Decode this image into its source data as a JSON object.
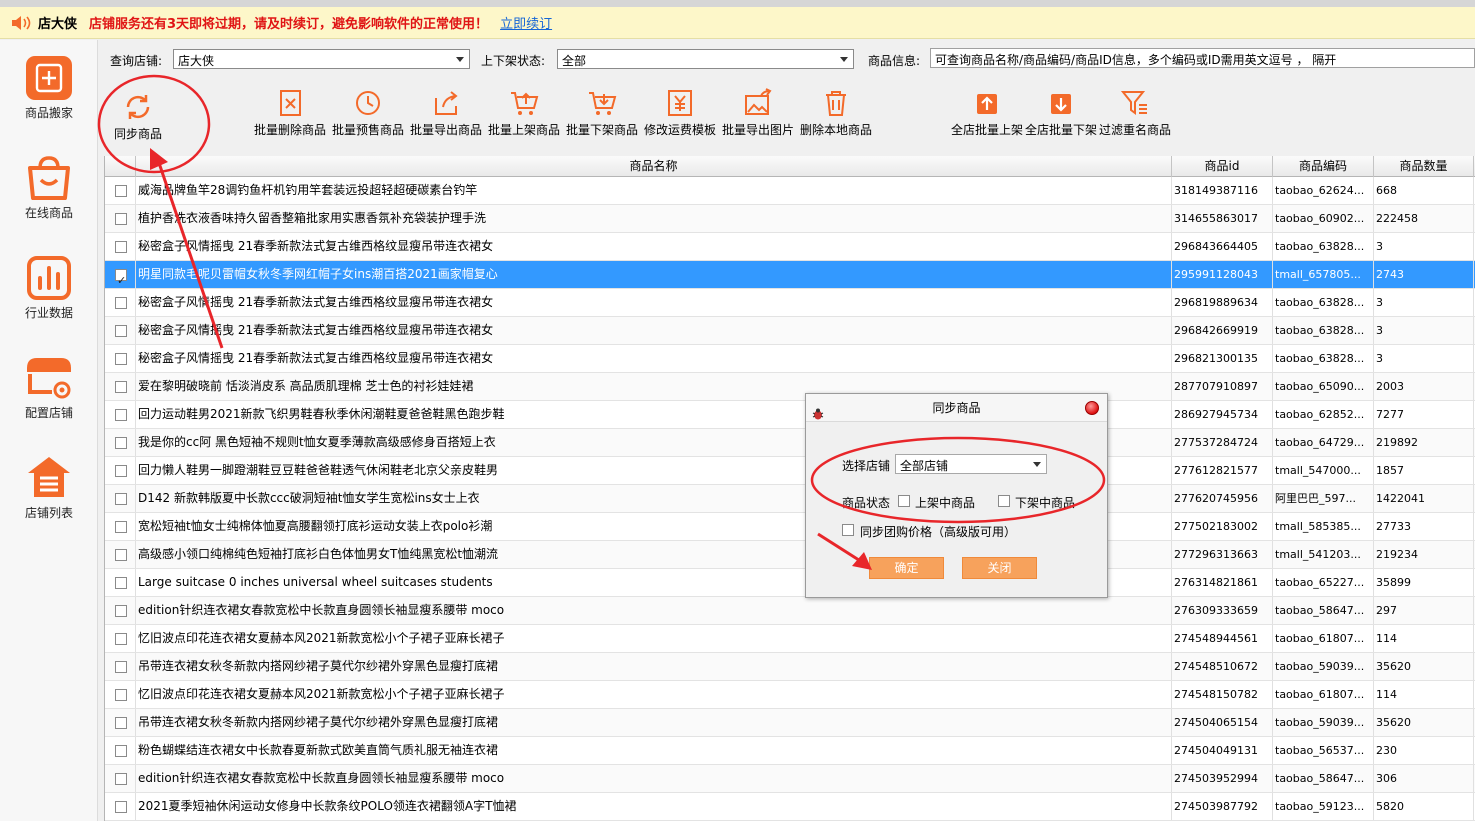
{
  "banner": {
    "brand": "店大侠",
    "message": "店铺服务还有3天即将过期，请及时续订，避免影响软件的正常使用！",
    "renew_link": "立即续订"
  },
  "sidebar": {
    "items": [
      {
        "label": "商品搬家",
        "icon": "product-move-icon"
      },
      {
        "label": "在线商品",
        "icon": "shopping-bag-icon"
      },
      {
        "label": "行业数据",
        "icon": "bar-chart-icon"
      },
      {
        "label": "配置店铺",
        "icon": "shop-settings-icon"
      },
      {
        "label": "店铺列表",
        "icon": "shop-list-icon"
      }
    ],
    "accent": "#f36a2a"
  },
  "filters": {
    "shop_label": "查询店铺:",
    "shop_value": "店大侠",
    "status_label": "上下架状态:",
    "status_value": "全部",
    "info_label": "商品信息:",
    "info_placeholder": "可查询商品名称/商品编码/商品ID信息，多个编码或ID需用英文逗号 ， 隔开"
  },
  "toolbar": {
    "sync": "同步商品",
    "batch_delete": "批量删除商品",
    "batch_presale": "批量预售商品",
    "batch_export": "批量导出商品",
    "batch_list": "批量上架商品",
    "batch_delist": "批量下架商品",
    "edit_shipping": "修改运费模板",
    "export_images": "批量导出图片",
    "delete_local": "删除本地商品",
    "shop_list_all": "全店批量上架",
    "shop_delist_all": "全店批量下架",
    "filter_dup": "过滤重名商品"
  },
  "table": {
    "headers": {
      "name": "商品名称",
      "id": "商品id",
      "code": "商品编码",
      "qty": "商品数量"
    },
    "rows": [
      {
        "name": "威海品牌鱼竿28调钓鱼杆机钓用竿套装远投超轻超硬碳素台钓竿",
        "id": "318149387116",
        "code": "taobao_62624...",
        "qty": "668",
        "checked": false
      },
      {
        "name": "植护香洗衣液香味持久留香整箱批家用实惠香氛补充袋装护理手洗",
        "id": "314655863017",
        "code": "taobao_60902...",
        "qty": "222458",
        "checked": false
      },
      {
        "name": "秘密盒子风情摇曳 21春季新款法式复古维西格纹显瘦吊带连衣裙女",
        "id": "296843664405",
        "code": "taobao_63828...",
        "qty": "3",
        "checked": false
      },
      {
        "name": "明星同款毛呢贝雷帽女秋冬季网红帽子女ins潮百搭2021画家帽复心",
        "id": "295991128043",
        "code": "tmall_657805...",
        "qty": "2743",
        "checked": true
      },
      {
        "name": "秘密盒子风情摇曳 21春季新款法式复古维西格纹显瘦吊带连衣裙女",
        "id": "296819889634",
        "code": "taobao_63828...",
        "qty": "3",
        "checked": false
      },
      {
        "name": "秘密盒子风情摇曳 21春季新款法式复古维西格纹显瘦吊带连衣裙女",
        "id": "296842669919",
        "code": "taobao_63828...",
        "qty": "3",
        "checked": false
      },
      {
        "name": "秘密盒子风情摇曳 21春季新款法式复古维西格纹显瘦吊带连衣裙女",
        "id": "296821300135",
        "code": "taobao_63828...",
        "qty": "3",
        "checked": false
      },
      {
        "name": "爱在黎明破晓前 恬淡消皮系 高品质肌理棉 芝士色的衬衫娃娃裙",
        "id": "287707910897",
        "code": "taobao_65090...",
        "qty": "2003",
        "checked": false
      },
      {
        "name": "回力运动鞋男2021新款飞织男鞋春秋季休闲潮鞋夏爸爸鞋黑色跑步鞋",
        "id": "286927945734",
        "code": "taobao_62852...",
        "qty": "7277",
        "checked": false
      },
      {
        "name": "我是你的cc阿 黑色短袖不规则t恤女夏季薄款高级感修身百搭短上衣",
        "id": "277537284724",
        "code": "taobao_64729...",
        "qty": "219892",
        "checked": false
      },
      {
        "name": "回力懒人鞋男一脚蹬潮鞋豆豆鞋爸爸鞋透气休闲鞋老北京父亲皮鞋男",
        "id": "277612821577",
        "code": "tmall_547000...",
        "qty": "1857",
        "checked": false
      },
      {
        "name": "D142 新款韩版夏中长款ccc破洞短袖t恤女学生宽松ins女士上衣",
        "id": "277620745956",
        "code": "阿里巴巴_597...",
        "qty": "1422041",
        "checked": false
      },
      {
        "name": "宽松短袖t恤女士纯棉体恤夏高腰翻领打底衫运动女装上衣polo衫潮",
        "id": "277502183002",
        "code": "tmall_585385...",
        "qty": "27733",
        "checked": false
      },
      {
        "name": "高级感小领口纯棉纯色短袖打底衫白色体恤男女T恤纯黑宽松t恤潮流",
        "id": "277296313663",
        "code": "tmall_541203...",
        "qty": "219234",
        "checked": false
      },
      {
        "name": "Large suitcase 0 inches universal wheel suitcases students",
        "id": "276314821861",
        "code": "taobao_65227...",
        "qty": "35899",
        "checked": false
      },
      {
        "name": "edition针织连衣裙女春款宽松中长款直身圆领长袖显瘦系腰带 moco",
        "id": "276309333659",
        "code": "taobao_58647...",
        "qty": "297",
        "checked": false
      },
      {
        "name": "忆旧波点印花连衣裙女夏赫本风2021新款宽松小个子裙子亚麻长裙子",
        "id": "274548944561",
        "code": "taobao_61807...",
        "qty": "114",
        "checked": false
      },
      {
        "name": "吊带连衣裙女秋冬新款内搭网纱裙子莫代尔纱裙外穿黑色显瘦打底裙",
        "id": "274548510672",
        "code": "taobao_59039...",
        "qty": "35620",
        "checked": false
      },
      {
        "name": "忆旧波点印花连衣裙女夏赫本风2021新款宽松小个子裙子亚麻长裙子",
        "id": "274548150782",
        "code": "taobao_61807...",
        "qty": "114",
        "checked": false
      },
      {
        "name": "吊带连衣裙女秋冬新款内搭网纱裙子莫代尔纱裙外穿黑色显瘦打底裙",
        "id": "274504065154",
        "code": "taobao_59039...",
        "qty": "35620",
        "checked": false
      },
      {
        "name": "粉色蝴蝶结连衣裙女中长款春夏新款式欧美直筒气质礼服无袖连衣裙",
        "id": "274504049131",
        "code": "taobao_56537...",
        "qty": "230",
        "checked": false
      },
      {
        "name": "edition针织连衣裙女春款宽松中长款直身圆领长袖显瘦系腰带 moco",
        "id": "274503952994",
        "code": "taobao_58647...",
        "qty": "306",
        "checked": false
      },
      {
        "name": "2021夏季短袖休闲运动女修身中长款条纹POLO领连衣裙翻领A字T恤裙",
        "id": "274503987792",
        "code": "taobao_59123...",
        "qty": "5820",
        "checked": false
      }
    ]
  },
  "dialog": {
    "title": "同步商品",
    "shop_label": "选择店铺",
    "shop_value": "全部店铺",
    "status_label": "商品状态",
    "on_shelf": "上架中商品",
    "off_shelf": "下架中商品",
    "group_price": "同步团购价格（高级版可用）",
    "confirm": "确定",
    "close": "关闭",
    "button_color": "#f7a25c"
  },
  "annotation_color": "#e8262a"
}
